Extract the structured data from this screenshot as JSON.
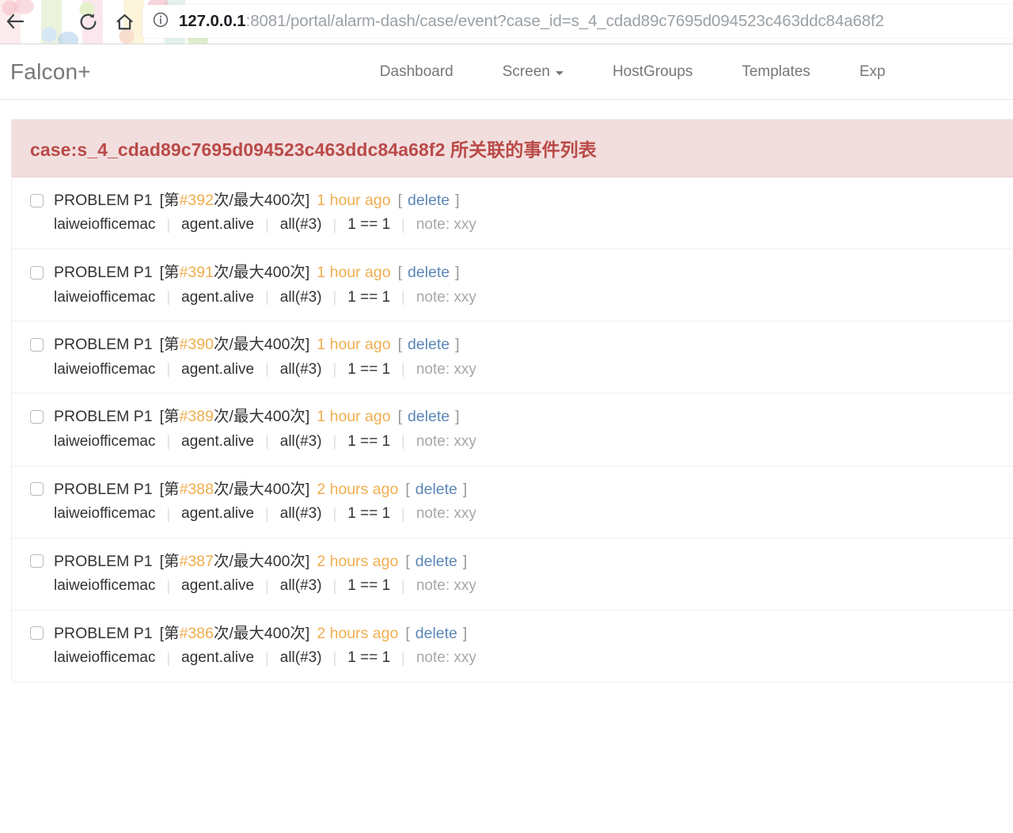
{
  "browser": {
    "url_host": "127.0.0.1",
    "url_rest": ":8081/portal/alarm-dash/case/event?case_id=s_4_cdad89c7695d094523c463ddc84a68f2",
    "back_icon": "back-arrow-icon",
    "reload_icon": "reload-icon",
    "home_icon": "home-icon",
    "info_icon": "site-info-icon"
  },
  "navbar": {
    "brand": "Falcon+",
    "links": [
      {
        "label": "Dashboard",
        "has_caret": false
      },
      {
        "label": "Screen",
        "has_caret": true
      },
      {
        "label": "HostGroups",
        "has_caret": false
      },
      {
        "label": "Templates",
        "has_caret": false
      },
      {
        "label": "Exp",
        "has_caret": false
      }
    ]
  },
  "panel": {
    "header": "case:s_4_cdad89c7695d094523c463ddc84a68f2 所关联的事件列表",
    "bracket_open": "[",
    "bracket_close": "]",
    "delete_label": "delete",
    "count_prefix": "[第",
    "count_middle": "次/最大",
    "count_suffix": "次]",
    "events": [
      {
        "status": "PROBLEM P1",
        "count": "#392",
        "max": "400",
        "time": "1 hour ago",
        "host": "laiweiofficemac",
        "metric": "agent.alive",
        "func": "all(#3)",
        "expr": "1 == 1",
        "note": "note: xxy"
      },
      {
        "status": "PROBLEM P1",
        "count": "#391",
        "max": "400",
        "time": "1 hour ago",
        "host": "laiweiofficemac",
        "metric": "agent.alive",
        "func": "all(#3)",
        "expr": "1 == 1",
        "note": "note: xxy"
      },
      {
        "status": "PROBLEM P1",
        "count": "#390",
        "max": "400",
        "time": "1 hour ago",
        "host": "laiweiofficemac",
        "metric": "agent.alive",
        "func": "all(#3)",
        "expr": "1 == 1",
        "note": "note: xxy"
      },
      {
        "status": "PROBLEM P1",
        "count": "#389",
        "max": "400",
        "time": "1 hour ago",
        "host": "laiweiofficemac",
        "metric": "agent.alive",
        "func": "all(#3)",
        "expr": "1 == 1",
        "note": "note: xxy"
      },
      {
        "status": "PROBLEM P1",
        "count": "#388",
        "max": "400",
        "time": "2 hours ago",
        "host": "laiweiofficemac",
        "metric": "agent.alive",
        "func": "all(#3)",
        "expr": "1 == 1",
        "note": "note: xxy"
      },
      {
        "status": "PROBLEM P1",
        "count": "#387",
        "max": "400",
        "time": "2 hours ago",
        "host": "laiweiofficemac",
        "metric": "agent.alive",
        "func": "all(#3)",
        "expr": "1 == 1",
        "note": "note: xxy"
      },
      {
        "status": "PROBLEM P1",
        "count": "#386",
        "max": "400",
        "time": "2 hours ago",
        "host": "laiweiofficemac",
        "metric": "agent.alive",
        "func": "all(#3)",
        "expr": "1 == 1",
        "note": "note: xxy"
      }
    ],
    "separator": "|"
  },
  "colors": {
    "accent_orange": "#f0ad4e",
    "link_blue": "#5b87b8",
    "alert_bg": "#f2dede",
    "alert_fg": "#b94a48",
    "text": "#333333",
    "muted": "#a8a8a8"
  }
}
